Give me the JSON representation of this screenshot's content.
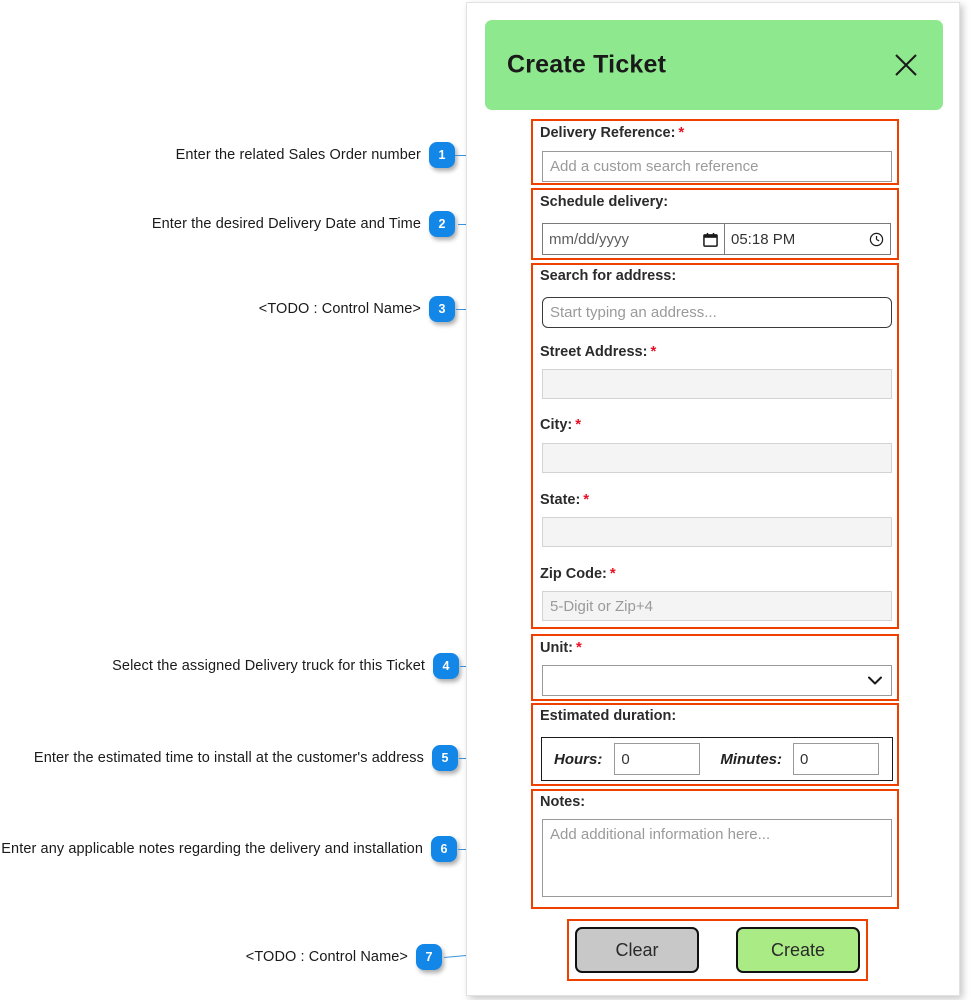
{
  "modal": {
    "title": "Create Ticket",
    "close_icon": "close-x-icon",
    "header_color": "#8ee88e"
  },
  "fields": {
    "delivery_reference": {
      "label": "Delivery Reference:",
      "required_marker": "*",
      "placeholder": "Add a custom search reference",
      "value": ""
    },
    "schedule_delivery": {
      "label": "Schedule delivery:",
      "date_placeholder": "mm/dd/yyyy",
      "date_value": "mm/dd/yyyy",
      "date_icon": "calendar-icon",
      "time_value": "05:18 PM",
      "time_icon": "clock-icon"
    },
    "search_address": {
      "label": "Search for address:",
      "placeholder": "Start typing an address...",
      "value": ""
    },
    "street_address": {
      "label": "Street Address:",
      "required_marker": "*",
      "placeholder": "",
      "value": ""
    },
    "city": {
      "label": "City:",
      "required_marker": "*",
      "placeholder": "",
      "value": ""
    },
    "state": {
      "label": "State:",
      "required_marker": "*",
      "placeholder": "",
      "value": ""
    },
    "zip_code": {
      "label": "Zip Code:",
      "required_marker": "*",
      "placeholder": "5-Digit or Zip+4",
      "value": ""
    },
    "unit": {
      "label": "Unit:",
      "required_marker": "*",
      "selected": "",
      "chevron_icon": "chevron-down-icon"
    },
    "estimated_duration": {
      "label": "Estimated duration:",
      "hours_label": "Hours:",
      "hours_value": "0",
      "minutes_label": "Minutes:",
      "minutes_value": "0"
    },
    "notes": {
      "label": "Notes:",
      "placeholder": "Add additional information here...",
      "value": ""
    }
  },
  "actions": {
    "clear_label": "Clear",
    "create_label": "Create",
    "clear_color": "#c8c8c8",
    "create_color": "#aaeb86"
  },
  "annotations": [
    {
      "number": "1",
      "text": "Enter the related Sales Order number"
    },
    {
      "number": "2",
      "text": "Enter the desired Delivery Date and Time"
    },
    {
      "number": "3",
      "text": "<TODO : Control Name>"
    },
    {
      "number": "4",
      "text": "Select the assigned Delivery truck for this Ticket"
    },
    {
      "number": "5",
      "text": "Enter the estimated time to install at the customer's address"
    },
    {
      "number": "6",
      "text": "Enter any applicable notes regarding the delivery and installation"
    },
    {
      "number": "7",
      "text": "<TODO : Control Name>"
    }
  ],
  "colors": {
    "highlight_border": "#f04000",
    "callout_badge": "#1287e8",
    "leader_line": "#3b93dd",
    "required_asterisk": "#e81123"
  }
}
